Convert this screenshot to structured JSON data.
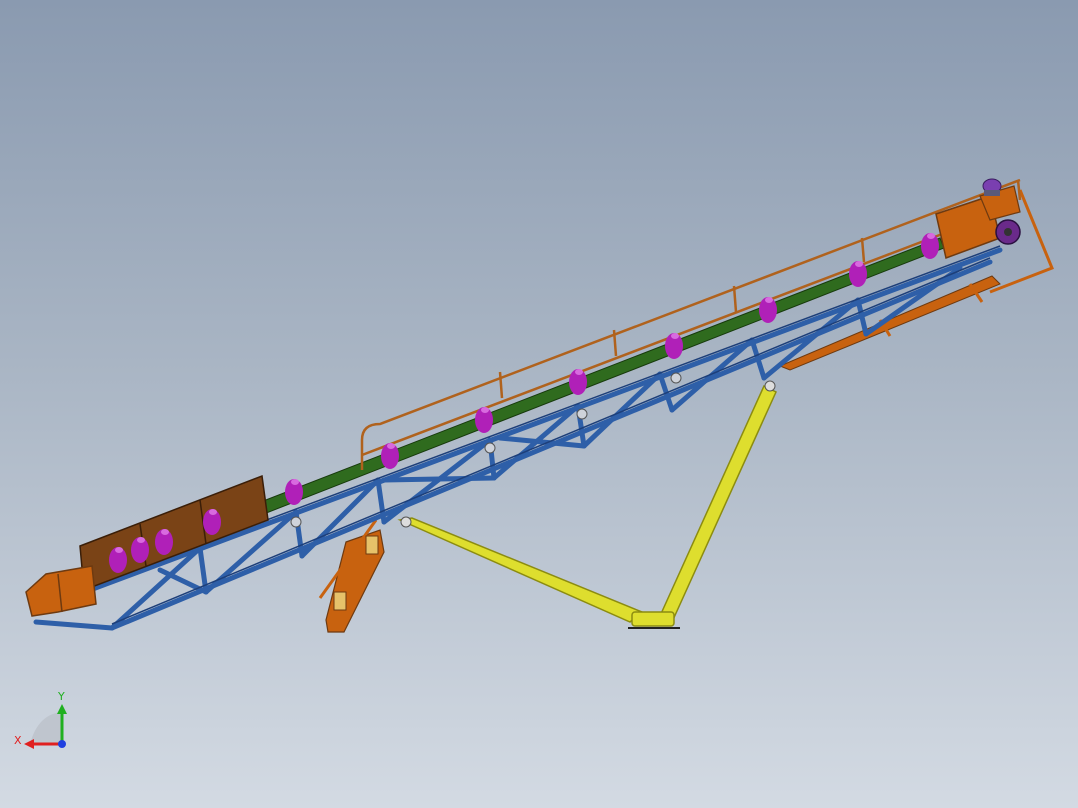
{
  "viewport": {
    "background_top": "#8a9ab0",
    "background_bottom": "#d3dae3"
  },
  "colors": {
    "frame": "#2e5fa8",
    "frame_dark": "#1d3f7a",
    "belt": "#2f6b1e",
    "idler": "#b020b8",
    "idler_light": "#d86adf",
    "railing": "#b0621d",
    "hopper": "#c8620f",
    "hopper_dark": "#6e3a10",
    "skirt": "#7a4316",
    "support_leg": "#dede2e",
    "support_leg_dark": "#8c8c10",
    "motor": "#7a3fb0"
  },
  "components": [
    "conveyor-truss-frame",
    "conveyor-belt",
    "carrying-idlers",
    "guard-railing",
    "feed-hopper",
    "head-drive",
    "support-legs",
    "tail-support",
    "underside-brace"
  ],
  "triad": {
    "x_label": "X",
    "y_label": "Y",
    "x_color": "#e02020",
    "y_color": "#20b020",
    "z_color": "#2040e0"
  }
}
